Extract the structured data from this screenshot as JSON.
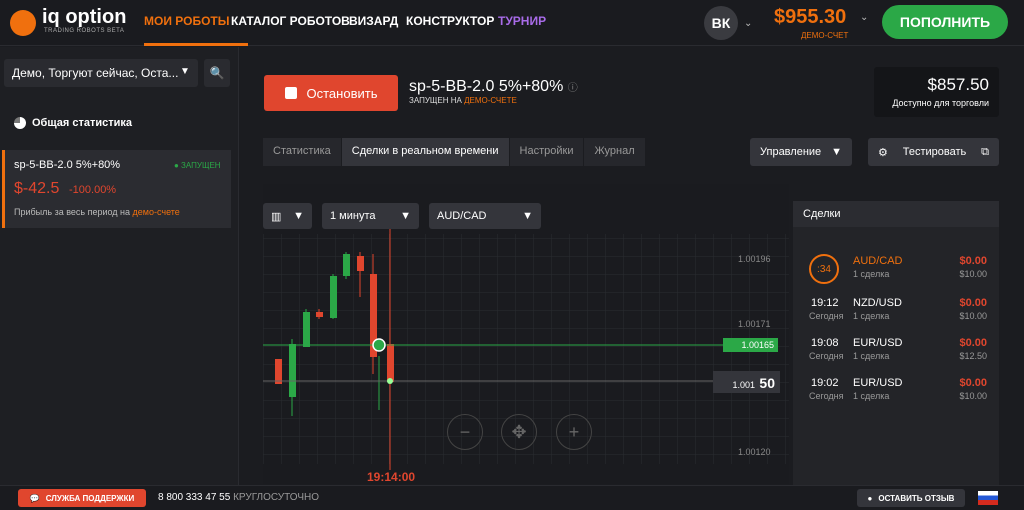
{
  "header": {
    "logo": "iq option",
    "logo_sub": "TRADING ROBOTS BETA",
    "nav": [
      "МОИ РОБОТЫ",
      "КАТАЛОГ РОБОТОВ",
      "ВИЗАРД",
      "КОНСТРУКТОР",
      "ТУРНИР"
    ],
    "avatar": "ВК",
    "balance": "$955.30",
    "balance_label": "ДЕМО-СЧЕТ",
    "deposit": "ПОПОЛНИТЬ"
  },
  "sidebar": {
    "filter": "Демо, Торгуют сейчас, Оста...",
    "stats_title": "Общая статистика",
    "robot": {
      "name": "sp-5-BB-2.0 5%+80%",
      "status": "● ЗАПУЩЕН",
      "profit": "$-42.5",
      "percent": "-100.00%",
      "desc": "Прибыль за весь период на",
      "desc_link": "демо-счете"
    }
  },
  "main": {
    "stop": "Остановить",
    "robot_name": "sp-5-BB-2.0 5%+80%",
    "started": "ЗАПУЩЕН НА",
    "started_link": "ДЕМО-СЧЕТЕ",
    "available_amount": "$857.50",
    "available_label": "Доступно для торговли",
    "tabs": [
      "Статистика",
      "Сделки в реальном времени",
      "Настройки",
      "Журнал"
    ],
    "control": "Управление",
    "test": "Тестировать"
  },
  "chart": {
    "period": "1 минута",
    "pair": "AUD/CAD",
    "price_labels": [
      "1.00196",
      "1.00171",
      "1.00120"
    ],
    "entry_price": "1.00165",
    "current_price_main": "1.001",
    "current_price_big": "50",
    "time": "19:14:00"
  },
  "deals": {
    "title": "Сделки",
    "items": [
      {
        "time": ":34",
        "day": "",
        "pair": "AUD/CAD",
        "count": "1 сделка",
        "profit": "$0.00",
        "amount": "$10.00",
        "active": true
      },
      {
        "time": "19:12",
        "day": "Сегодня",
        "pair": "NZD/USD",
        "count": "1 сделка",
        "profit": "$0.00",
        "amount": "$10.00",
        "active": false
      },
      {
        "time": "19:08",
        "day": "Сегодня",
        "pair": "EUR/USD",
        "count": "1 сделка",
        "profit": "$0.00",
        "amount": "$12.50",
        "active": false
      },
      {
        "time": "19:02",
        "day": "Сегодня",
        "pair": "EUR/USD",
        "count": "1 сделка",
        "profit": "$0.00",
        "amount": "$10.00",
        "active": false
      }
    ]
  },
  "footer": {
    "support": "СЛУЖБА ПОДДЕРЖКИ",
    "phone": "8 800 333 47 55",
    "hours": "КРУГЛОСУТОЧНО",
    "review": "ОСТАВИТЬ ОТЗЫВ"
  },
  "colors": {
    "accent": "#f0700e",
    "green": "#2ba847",
    "red": "#e0462e"
  }
}
